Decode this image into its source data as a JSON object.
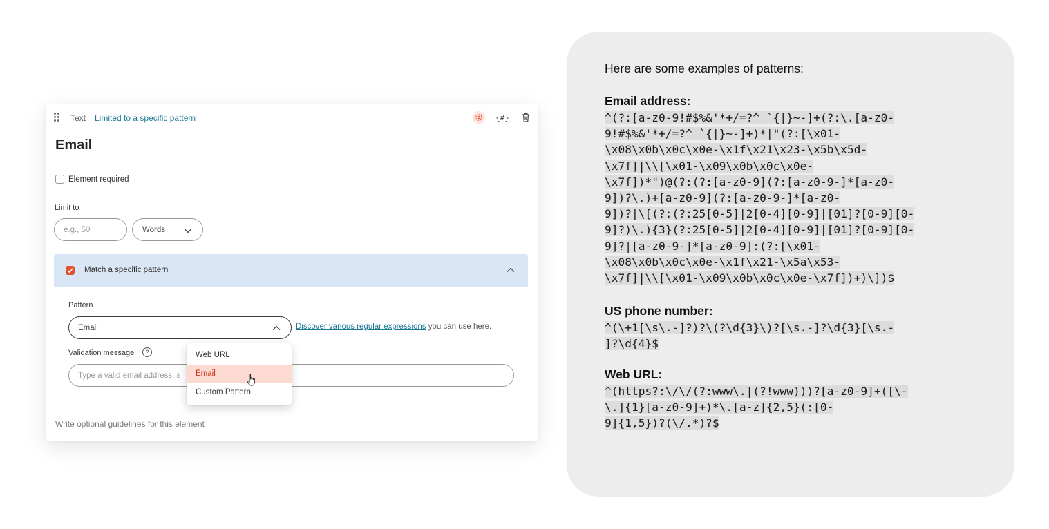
{
  "form": {
    "type_label": "Text",
    "pattern_link": "Limited to a specific pattern",
    "title": "Email",
    "required_label": "Element required",
    "limit_label": "Limit to",
    "limit_placeholder": "e.g., 50",
    "limit_unit": "Words",
    "match_label": "Match a specific pattern",
    "pattern_label": "Pattern",
    "pattern_value": "Email",
    "helper_link": "Discover various regular expressions",
    "helper_rest": " you can use here.",
    "validation_label": "Validation message",
    "help_glyph": "?",
    "validation_placeholder": "Type a valid email address, s",
    "guidelines": "Write optional guidelines for this element",
    "dropdown_options": [
      "Web URL",
      "Email",
      "Custom Pattern"
    ],
    "selected_option": "Email",
    "accent_color": "#e3522f",
    "link_color": "#1d7a95"
  },
  "examples": {
    "intro": "Here are some examples of patterns:",
    "email_heading": "Email address:",
    "email_lines": [
      "^(?:[a-z0-9!#$%&'*+/=?^_`{|}~-]+(?:\\.[a-z0-",
      "9!#$%&'*+/=?^_`{|}~-]+)*|\"(?:[\\x01-",
      "\\x08\\x0b\\x0c\\x0e-\\x1f\\x21\\x23-\\x5b\\x5d-",
      "\\x7f]|\\\\[\\x01-\\x09\\x0b\\x0c\\x0e-",
      "\\x7f])*\")@(?:(?:[a-z0-9](?:[a-z0-9-]*[a-z0-",
      "9])?\\.)+[a-z0-9](?:[a-z0-9-]*[a-z0-",
      "9])?|\\[(?:(?:25[0-5]|2[0-4][0-9]|[01]?[0-9][0-",
      "9]?)\\.){3}(?:25[0-5]|2[0-4][0-9]|[01]?[0-9][0-",
      "9]?|[a-z0-9-]*[a-z0-9]:(?:[\\x01-",
      "\\x08\\x0b\\x0c\\x0e-\\x1f\\x21-\\x5a\\x53-",
      "\\x7f]|\\\\[\\x01-\\x09\\x0b\\x0c\\x0e-\\x7f])+)\\])$"
    ],
    "phone_heading": "US phone number:",
    "phone_lines": [
      "^(\\+1[\\s\\.-]?)?\\(?\\d{3}\\)?[\\s.-]?\\d{3}[\\s.-",
      "]?\\d{4}$"
    ],
    "url_heading": "Web URL:",
    "url_lines": [
      "^(https?:\\/\\/(?:www\\.|(?!www)))?[a-z0-9]+([\\-",
      "\\.]{1}[a-z0-9]+)*\\.[a-z]{2,5}(:[0-",
      "9]{1,5})?(\\/.*)?$"
    ]
  }
}
